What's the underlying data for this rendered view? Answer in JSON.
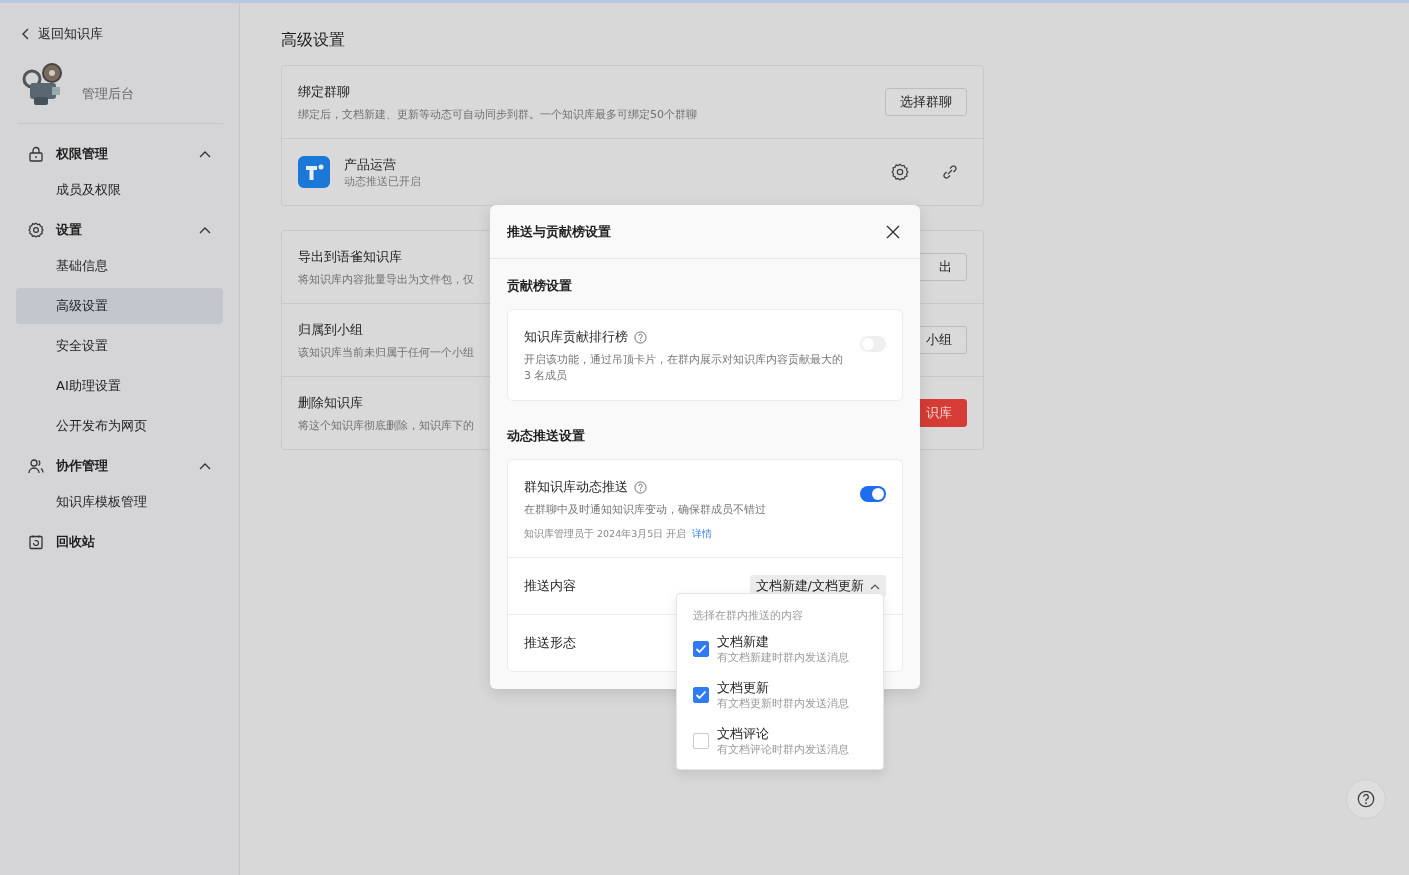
{
  "back_link": "返回知识库",
  "workspace": {
    "subtitle": "管理后台"
  },
  "sidebar": {
    "sections": [
      {
        "title": "权限管理",
        "expanded": true,
        "items": [
          {
            "label": "成员及权限",
            "selected": false
          }
        ]
      },
      {
        "title": "设置",
        "expanded": true,
        "items": [
          {
            "label": "基础信息",
            "selected": false
          },
          {
            "label": "高级设置",
            "selected": true
          },
          {
            "label": "安全设置",
            "selected": false
          },
          {
            "label": "AI助理设置",
            "selected": false
          },
          {
            "label": "公开发布为网页",
            "selected": false
          }
        ]
      },
      {
        "title": "协作管理",
        "expanded": true,
        "items": [
          {
            "label": "知识库模板管理",
            "selected": false
          }
        ]
      },
      {
        "title": "回收站"
      }
    ]
  },
  "page_title": "高级设置",
  "binding": {
    "title": "绑定群聊",
    "description": "绑定后，文档新建、更新等动态可自动同步到群。一个知识库最多可绑定50个群聊",
    "button": "选择群聊",
    "groups": [
      {
        "name": "产品运营",
        "status": "动态推送已开启"
      }
    ]
  },
  "settings_cards": [
    {
      "title": "导出到语雀知识库",
      "description": "将知识库内容批量导出为文件包，仅",
      "button": "出",
      "kind": "default"
    },
    {
      "title": "归属到小组",
      "description": "该知识库当前未归属于任何一个小组",
      "button": "小组",
      "kind": "default"
    },
    {
      "title": "删除知识库",
      "description": "将这个知识库彻底删除，知识库下的",
      "button": "识库",
      "kind": "danger"
    }
  ],
  "modal": {
    "title": "推送与贡献榜设置",
    "contribution": {
      "heading": "贡献榜设置",
      "title": "知识库贡献排行榜",
      "description": "开启该功能，通过吊顶卡片，在群内展示对知识库内容贡献最大的 3 名成员",
      "on": false
    },
    "push": {
      "heading": "动态推送设置",
      "title": "群知识库动态推送",
      "description": "在群聊中及时通知知识库变动，确保群成员不错过",
      "meta": "知识库管理员于 2024年3月5日 开启",
      "link": "详情",
      "on": true,
      "rows": [
        {
          "label": "推送内容",
          "value": "文档新建/文档更新",
          "expanded": true
        },
        {
          "label": "推送形态"
        }
      ]
    },
    "dropdown": {
      "header": "选择在群内推送的内容",
      "options": [
        {
          "label": "文档新建",
          "description": "有文档新建时群内发送消息",
          "checked": true
        },
        {
          "label": "文档更新",
          "description": "有文档更新时群内发送消息",
          "checked": true
        },
        {
          "label": "文档评论",
          "description": "有文档评论时群内发送消息",
          "checked": false
        }
      ]
    }
  }
}
